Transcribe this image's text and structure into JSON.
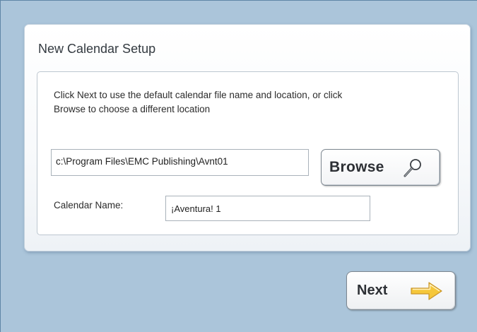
{
  "dialog": {
    "title": "New Calendar Setup",
    "instructions": "Click Next to use the default calendar file name and location, or click Browse to choose a different location",
    "location": {
      "value": "c:\\Program Files\\EMC Publishing\\Avnt01"
    },
    "browse_button": {
      "label": "Browse",
      "icon": "magnifier-icon"
    },
    "calendar_name": {
      "label": "Calendar Name:",
      "value": "¡Aventura! 1"
    },
    "next_button": {
      "label": "Next",
      "icon": "arrow-right-icon",
      "icon_color": "#f5c73a"
    }
  },
  "colors": {
    "background": "#abc5da",
    "panel": "#ffffff",
    "text": "#2c2c2c"
  }
}
